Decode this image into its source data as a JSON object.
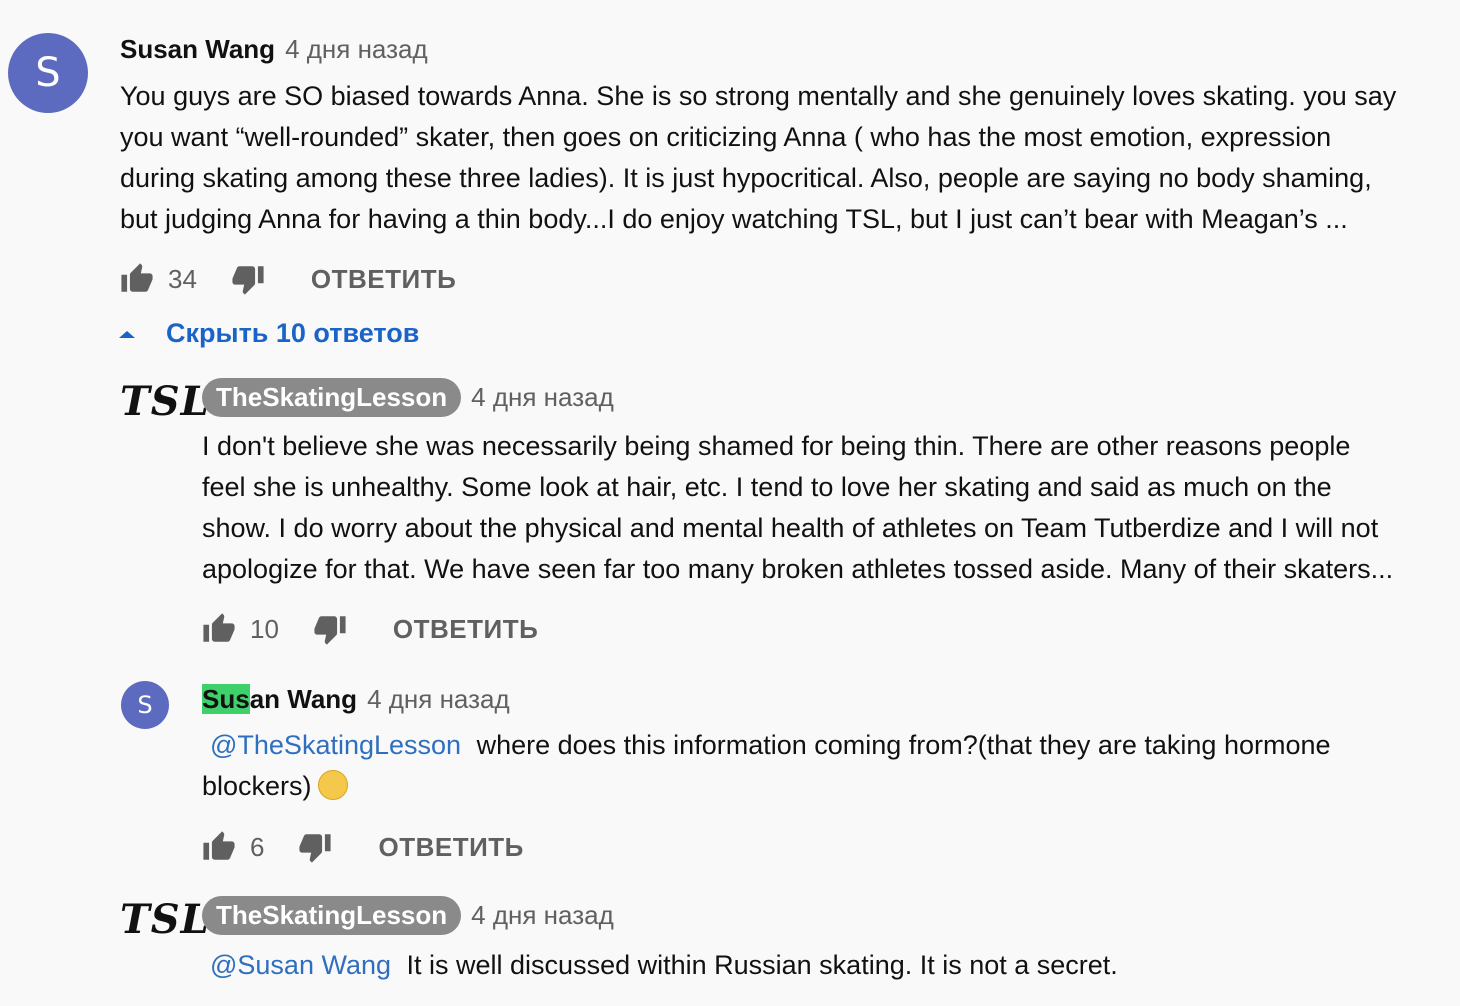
{
  "comments": [
    {
      "author": "Susan Wang",
      "avatar_letter": "S",
      "time": "4 дня назад",
      "lines": [
        "You guys are SO biased towards Anna. She is so strong mentally and she genuinely loves skating. you say",
        "you want “well-rounded” skater, then goes on criticizing Anna ( who has the most emotion, expression",
        "during skating among these three ladies). It is just hypocritical. Also, people are saying no body shaming,",
        "but judging Anna for having a thin body...I do enjoy watching TSL, but I just can’t bear with Meagan’s ..."
      ],
      "likes": "34",
      "reply_label": "ОТВЕТИТЬ"
    }
  ],
  "toggle": {
    "icon": "caret-up-icon",
    "label": "Скрыть 10 ответов"
  },
  "replies": [
    {
      "author": "TheSkatingLesson",
      "avatar_text": "TSL",
      "time": "4 дня назад",
      "lines": [
        "I don't believe she was necessarily being shamed for being thin. There are other reasons people",
        "feel she is unhealthy. Some look at hair, etc. I tend to love her skating and said as much on the",
        "show. I do worry about the physical and mental health of athletes on Team Tutberdize and I will not",
        "apologize for that. We have seen far too many broken athletes tossed aside. Many of their skaters..."
      ],
      "likes": "10",
      "reply_label": "ОТВЕТИТЬ"
    },
    {
      "author_highlight": "Sus",
      "author_rest": "an Wang",
      "avatar_letter": "S",
      "time": "4 дня назад",
      "mention": "@TheSkatingLesson",
      "line1_rest": "where does this information coming from?(that they are taking hormone",
      "line2": "blockers)",
      "emoji": "hushed-face-emoji",
      "likes": "6",
      "reply_label": "ОТВЕТИТЬ"
    },
    {
      "author": "TheSkatingLesson",
      "avatar_text": "TSL",
      "time": "4 дня назад",
      "mention": "@Susan Wang",
      "text": "It is well discussed within Russian skating. It is not a secret."
    }
  ],
  "colors": {
    "background": "#f9f9f9",
    "avatar": "#5c6bc0",
    "link": "#1a64c8",
    "badge": "#8a8a8a",
    "highlight": "#3ed06a"
  }
}
